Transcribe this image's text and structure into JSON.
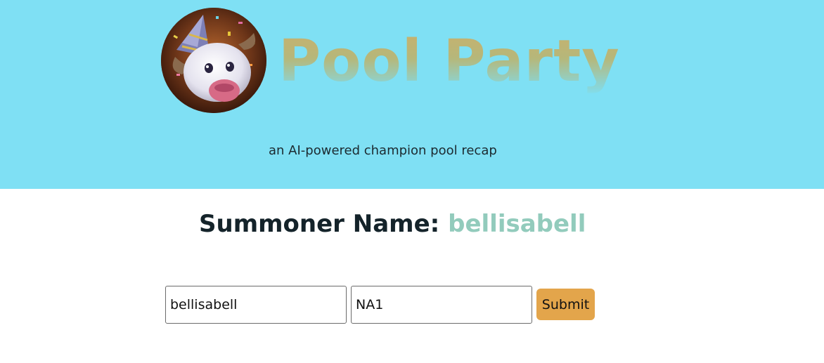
{
  "header": {
    "title": "Pool Party",
    "tagline": "an AI-powered champion pool recap",
    "background_color": "#7fe0f4",
    "logo_icon": "poro-party-avatar"
  },
  "summoner": {
    "label": "Summoner Name:",
    "name": "bellisabell",
    "name_color": "#92cbbc"
  },
  "form": {
    "name_value": "bellisabell",
    "region_value": "NA1",
    "submit_label": "Submit",
    "submit_color": "#e3a54b"
  }
}
